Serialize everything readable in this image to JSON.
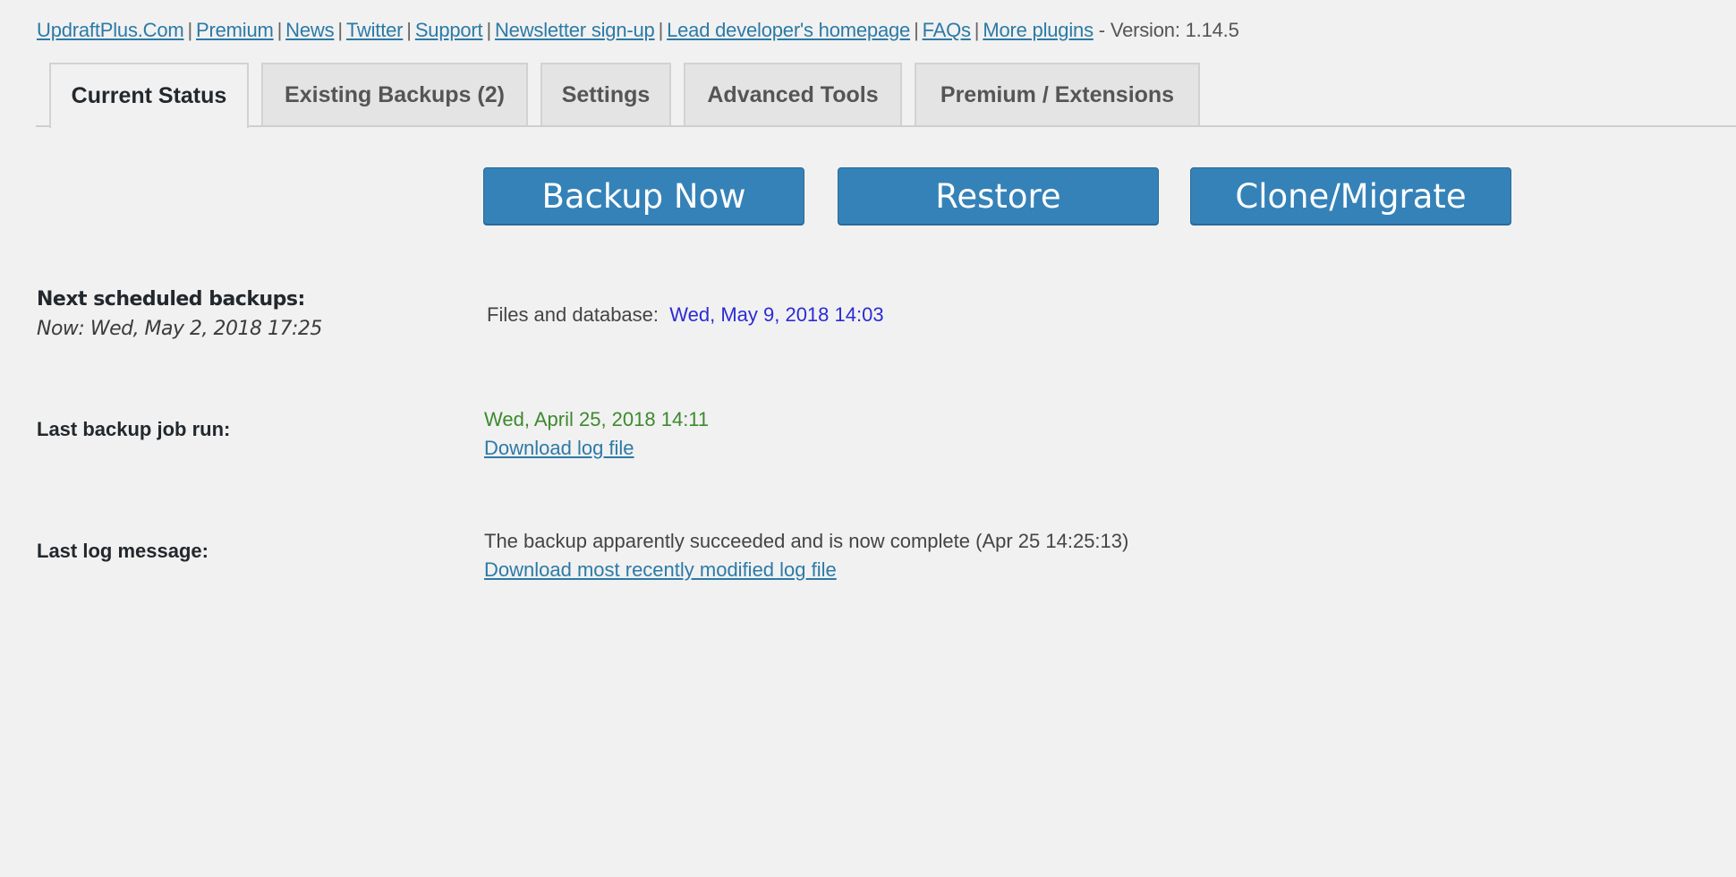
{
  "header": {
    "links": [
      {
        "label": "UpdraftPlus.Com"
      },
      {
        "label": "Premium"
      },
      {
        "label": "News"
      },
      {
        "label": "Twitter"
      },
      {
        "label": "Support"
      },
      {
        "label": "Newsletter sign-up"
      },
      {
        "label": "Lead developer's homepage"
      },
      {
        "label": "FAQs"
      },
      {
        "label": "More plugins"
      }
    ],
    "separator": "|",
    "version": "- Version: 1.14.5"
  },
  "tabs": [
    {
      "label": "Current Status",
      "active": true
    },
    {
      "label": "Existing Backups (2)",
      "active": false
    },
    {
      "label": "Settings",
      "active": false
    },
    {
      "label": "Advanced Tools",
      "active": false
    },
    {
      "label": "Premium / Extensions",
      "active": false
    }
  ],
  "actions": {
    "backup_now": "Backup Now",
    "restore": "Restore",
    "clone_migrate": "Clone/Migrate"
  },
  "status": {
    "next_scheduled": {
      "label": "Next scheduled backups:",
      "now": "Now: Wed, May 2, 2018 17:25",
      "files_db_label": "Files and database:",
      "files_db_time": "Wed, May 9, 2018 14:03"
    },
    "last_backup": {
      "label": "Last backup job run:",
      "time": "Wed, April 25, 2018 14:11",
      "download_link": "Download log file"
    },
    "last_log": {
      "label": "Last log message:",
      "message": "The backup apparently succeeded and is now complete (Apr 25 14:25:13)",
      "download_link": "Download most recently modified log file"
    }
  },
  "colors": {
    "button_bg": "#3582b8",
    "link": "#2c7aa6",
    "scheduled_time": "#2b2bd6",
    "last_run_time": "#3c8a2e",
    "page_bg": "#f1f1f1"
  }
}
